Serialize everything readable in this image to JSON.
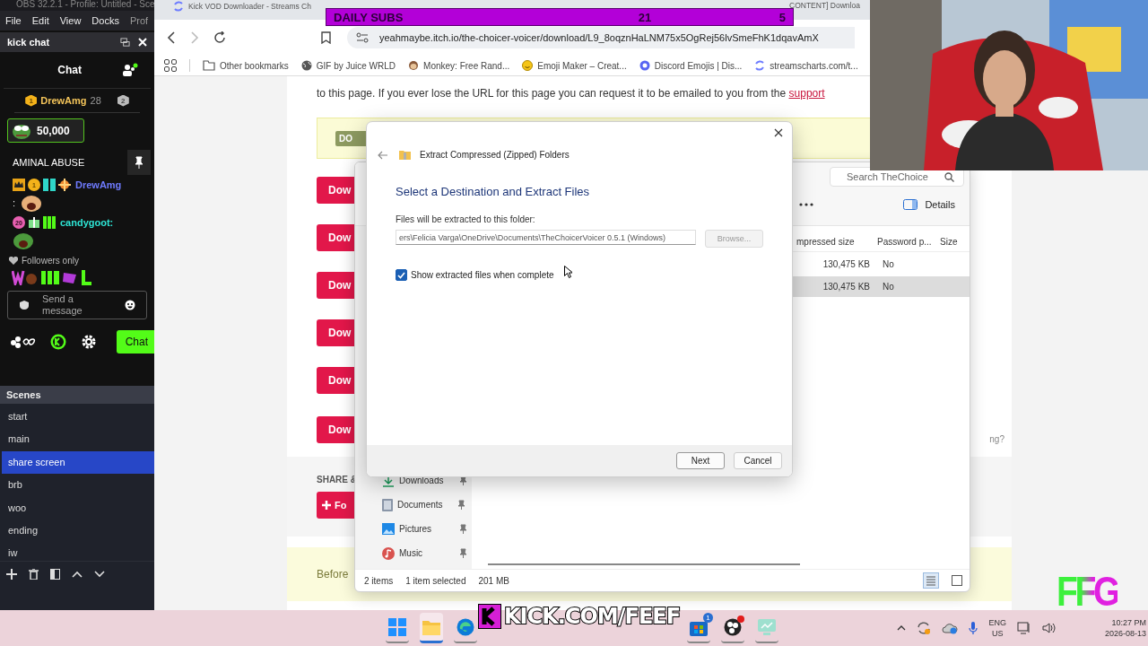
{
  "obs": {
    "title": "OBS 32.2.1 - Profile: Untitled - Sce",
    "menu": [
      "File",
      "Edit",
      "View",
      "Docks",
      "Prof"
    ],
    "chat_dock": {
      "title": "kick chat",
      "header": "Chat",
      "leaderboard": {
        "first_rank": "1",
        "user": "DrewAmg",
        "count": "28",
        "second_rank": "2"
      },
      "gift": {
        "amount": "50,000"
      },
      "messages": [
        {
          "kind": "text",
          "text": "AMINAL ABUSE"
        },
        {
          "kind": "user",
          "badges": [
            {
              "kind": "crown"
            },
            {
              "kind": "rank",
              "text": "1"
            },
            {
              "kind": "bg"
            },
            {
              "kind": "sparkle"
            }
          ],
          "user": "DrewAmg",
          "color": "#6f7bff",
          "separator": ":"
        },
        {
          "kind": "user",
          "badges": [
            {
              "kind": "sub",
              "text": "20"
            },
            {
              "kind": "gift"
            },
            {
              "kind": "tier"
            }
          ],
          "user": "candygoot:",
          "color": "#2ee6d6"
        }
      ],
      "mode": "Followers only",
      "input": {
        "placeholder": "Send a message"
      },
      "send_button": "Chat"
    },
    "scenes": {
      "title": "Scenes",
      "items": [
        {
          "label": "start",
          "selected": false
        },
        {
          "label": "main",
          "selected": false
        },
        {
          "label": "share screen",
          "selected": true
        },
        {
          "label": "brb",
          "selected": false
        },
        {
          "label": "woo",
          "selected": false
        },
        {
          "label": "ending",
          "selected": false
        },
        {
          "label": "iw",
          "selected": false
        }
      ]
    }
  },
  "browser": {
    "tabs": [
      {
        "title": "Kick VOD Downloader - Streams Ch"
      },
      {
        "title": "CONTENT] Downloa"
      }
    ],
    "url": "yeahmaybe.itch.io/the-choicer-voicer/download/L9_8oqznHaLNM75x5OgRej56lvSmeFhK1dqavAmX",
    "bookmarks": [
      {
        "kind": "folder",
        "label": "Other bookmarks"
      },
      {
        "kind": "globe",
        "label": "GIF by Juice WRLD"
      },
      {
        "kind": "monkey",
        "label": "Monkey: Free Rand..."
      },
      {
        "kind": "smiley",
        "label": "Emoji Maker – Creat..."
      },
      {
        "kind": "discord",
        "label": "Discord Emojis | Dis..."
      },
      {
        "kind": "streams",
        "label": "streamscharts.com/t..."
      }
    ],
    "page": {
      "intro": "to this page. If you ever lose the URL for this page you can request it to be emailed to you from the",
      "intro_link": "support",
      "notice_button": "DO",
      "downloads": [
        "Dow",
        "Dow",
        "Dow",
        "Dow",
        "Dow",
        "Dow"
      ],
      "side_text": "ng?",
      "share_heading": "SHARE &",
      "follow_button": "Fo",
      "note": "Before"
    }
  },
  "explorer": {
    "search_placeholder": "Search TheChoice",
    "details": "Details",
    "columns": [
      "mpressed size",
      "Password p...",
      "Size"
    ],
    "rows": [
      {
        "compressed_size": "130,475 KB",
        "password": "No",
        "selected": false
      },
      {
        "compressed_size": "130,475 KB",
        "password": "No",
        "selected": true
      }
    ],
    "nav": [
      {
        "kind": "downloads",
        "label": "Downloads"
      },
      {
        "kind": "documents",
        "label": "Documents"
      },
      {
        "kind": "pictures",
        "label": "Pictures"
      },
      {
        "kind": "music",
        "label": "Music"
      }
    ],
    "status": {
      "count": "2 items",
      "selection": "1 item selected",
      "size": "201 MB"
    }
  },
  "dialog": {
    "title": "Extract Compressed (Zipped) Folders",
    "heading": "Select a Destination and Extract Files",
    "field_label": "Files will be extracted to this folder:",
    "path": "ers\\Felicia Varga\\OneDrive\\Documents\\TheChoicerVoicer 0.5.1 (Windows)",
    "browse": {
      "label": "Browse...",
      "disabled": true
    },
    "checkbox": {
      "label": "Show extracted files when complete",
      "checked": true
    },
    "buttons": [
      "Next",
      "Cancel"
    ]
  },
  "overlays": {
    "daily_subs": {
      "label": "DAILY SUBS",
      "count": "21",
      "goal": "5"
    },
    "kick_link": "KICK.COM/FEEF",
    "logo": "FFG"
  },
  "taskbar": {
    "apps": [
      {
        "kind": "start",
        "active": false
      },
      {
        "kind": "explorer",
        "active": true
      },
      {
        "kind": "edge",
        "active": false
      },
      {
        "kind": "store",
        "badge": "1",
        "active": false
      },
      {
        "kind": "obs",
        "alert": true,
        "active": false
      },
      {
        "kind": "remote",
        "active": false
      }
    ],
    "language": "ENG",
    "region": "US",
    "time": "10:27 PM",
    "date": "2026-08-13"
  }
}
